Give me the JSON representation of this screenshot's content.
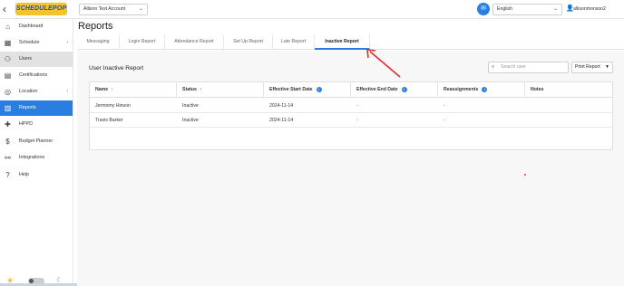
{
  "header": {
    "logo_text": "SCHEDULEPOP",
    "account_select": "Allison Test Account",
    "language_select": "English",
    "username": "allisonmonson2"
  },
  "sidebar": {
    "items": [
      {
        "label": "Dashboard",
        "icon": "home-icon"
      },
      {
        "label": "Schedule",
        "icon": "calendar-icon"
      },
      {
        "label": "Users",
        "icon": "users-icon"
      },
      {
        "label": "Certifications",
        "icon": "certificate-icon"
      },
      {
        "label": "Location",
        "icon": "location-pin-icon"
      },
      {
        "label": "Reports",
        "icon": "bar-chart-icon"
      },
      {
        "label": "HPPD",
        "icon": "plus-icon"
      },
      {
        "label": "Budget Planner",
        "icon": "dollar-icon"
      },
      {
        "label": "Integrations",
        "icon": "link-icon"
      },
      {
        "label": "Help",
        "icon": "help-icon"
      }
    ],
    "selected": "Users",
    "active": "Reports"
  },
  "page": {
    "title": "Reports"
  },
  "tabs": [
    "Messaging",
    "Login Report",
    "Attendance Report",
    "Set Up Report",
    "Late Report",
    "Inactive Report"
  ],
  "active_tab": "Inactive Report",
  "report": {
    "title": "User Inactive Report",
    "search_placeholder": "Search user",
    "print_label": "Print Report",
    "columns": [
      "Name",
      "Status",
      "Effective Start Date",
      "Effective End Date",
      "Reassignments",
      "Notes"
    ],
    "rows": [
      [
        "Jermomy Hinson",
        "Inactive",
        "2024-11-14",
        "-",
        "-",
        ""
      ],
      [
        "Travis Barker",
        "Inactive",
        "2024-11-14",
        "-",
        "-",
        ""
      ]
    ]
  },
  "colors": {
    "accent": "#2a7de1",
    "annotation": "#d9312f",
    "logo_bg": "#f4c430"
  }
}
